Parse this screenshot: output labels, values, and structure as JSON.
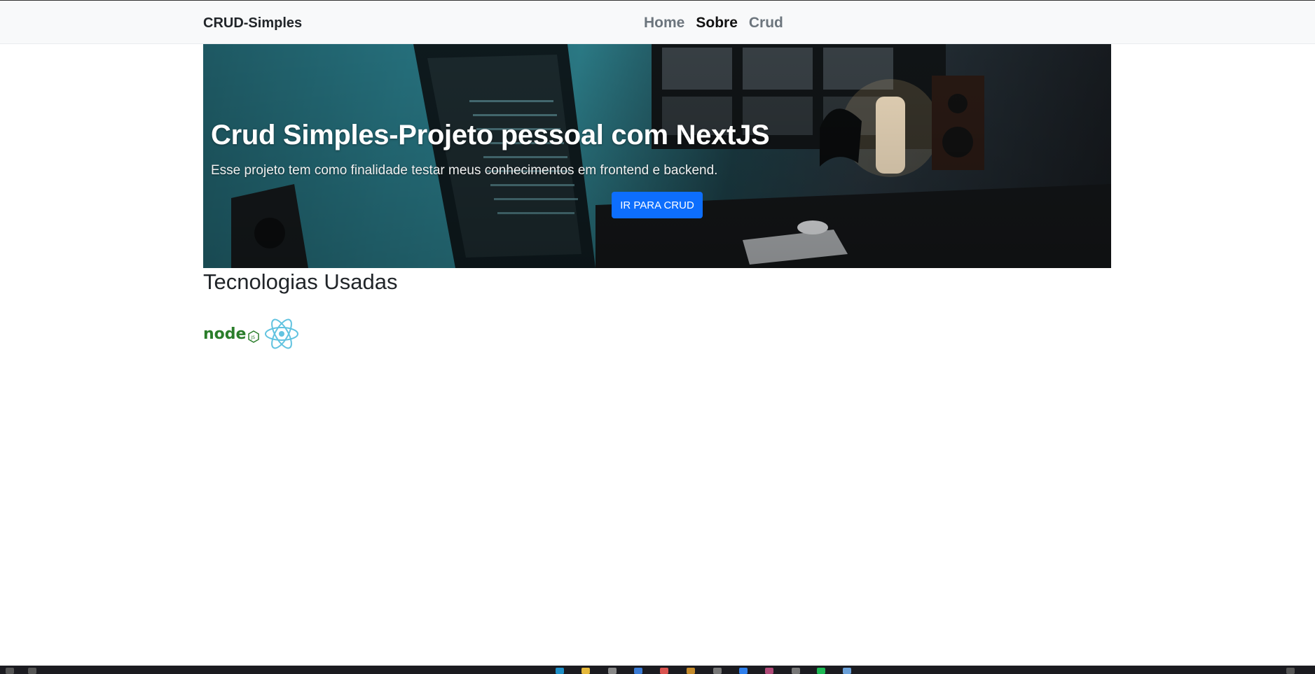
{
  "navbar": {
    "brand": "CRUD-Simples",
    "links": [
      {
        "label": "Home",
        "active": false
      },
      {
        "label": "Sobre",
        "active": true
      },
      {
        "label": "Crud",
        "active": false
      }
    ]
  },
  "hero": {
    "title": "Crud Simples-Projeto pessoal com NextJS",
    "subtitle": "Esse projeto tem como finalidade testar meus conhecimentos em frontend e backend.",
    "button_label": "IR PARA CRUD"
  },
  "tech": {
    "title": "Tecnologias Usadas",
    "logos": [
      {
        "icon": "nodejs-logo",
        "label": "node"
      },
      {
        "icon": "react-logo"
      }
    ]
  },
  "colors": {
    "navbar_bg": "#f8f9fa",
    "button_bg": "#0d6efd",
    "node_green": "#2a7d2a",
    "react_blue": "#61c3e0"
  }
}
